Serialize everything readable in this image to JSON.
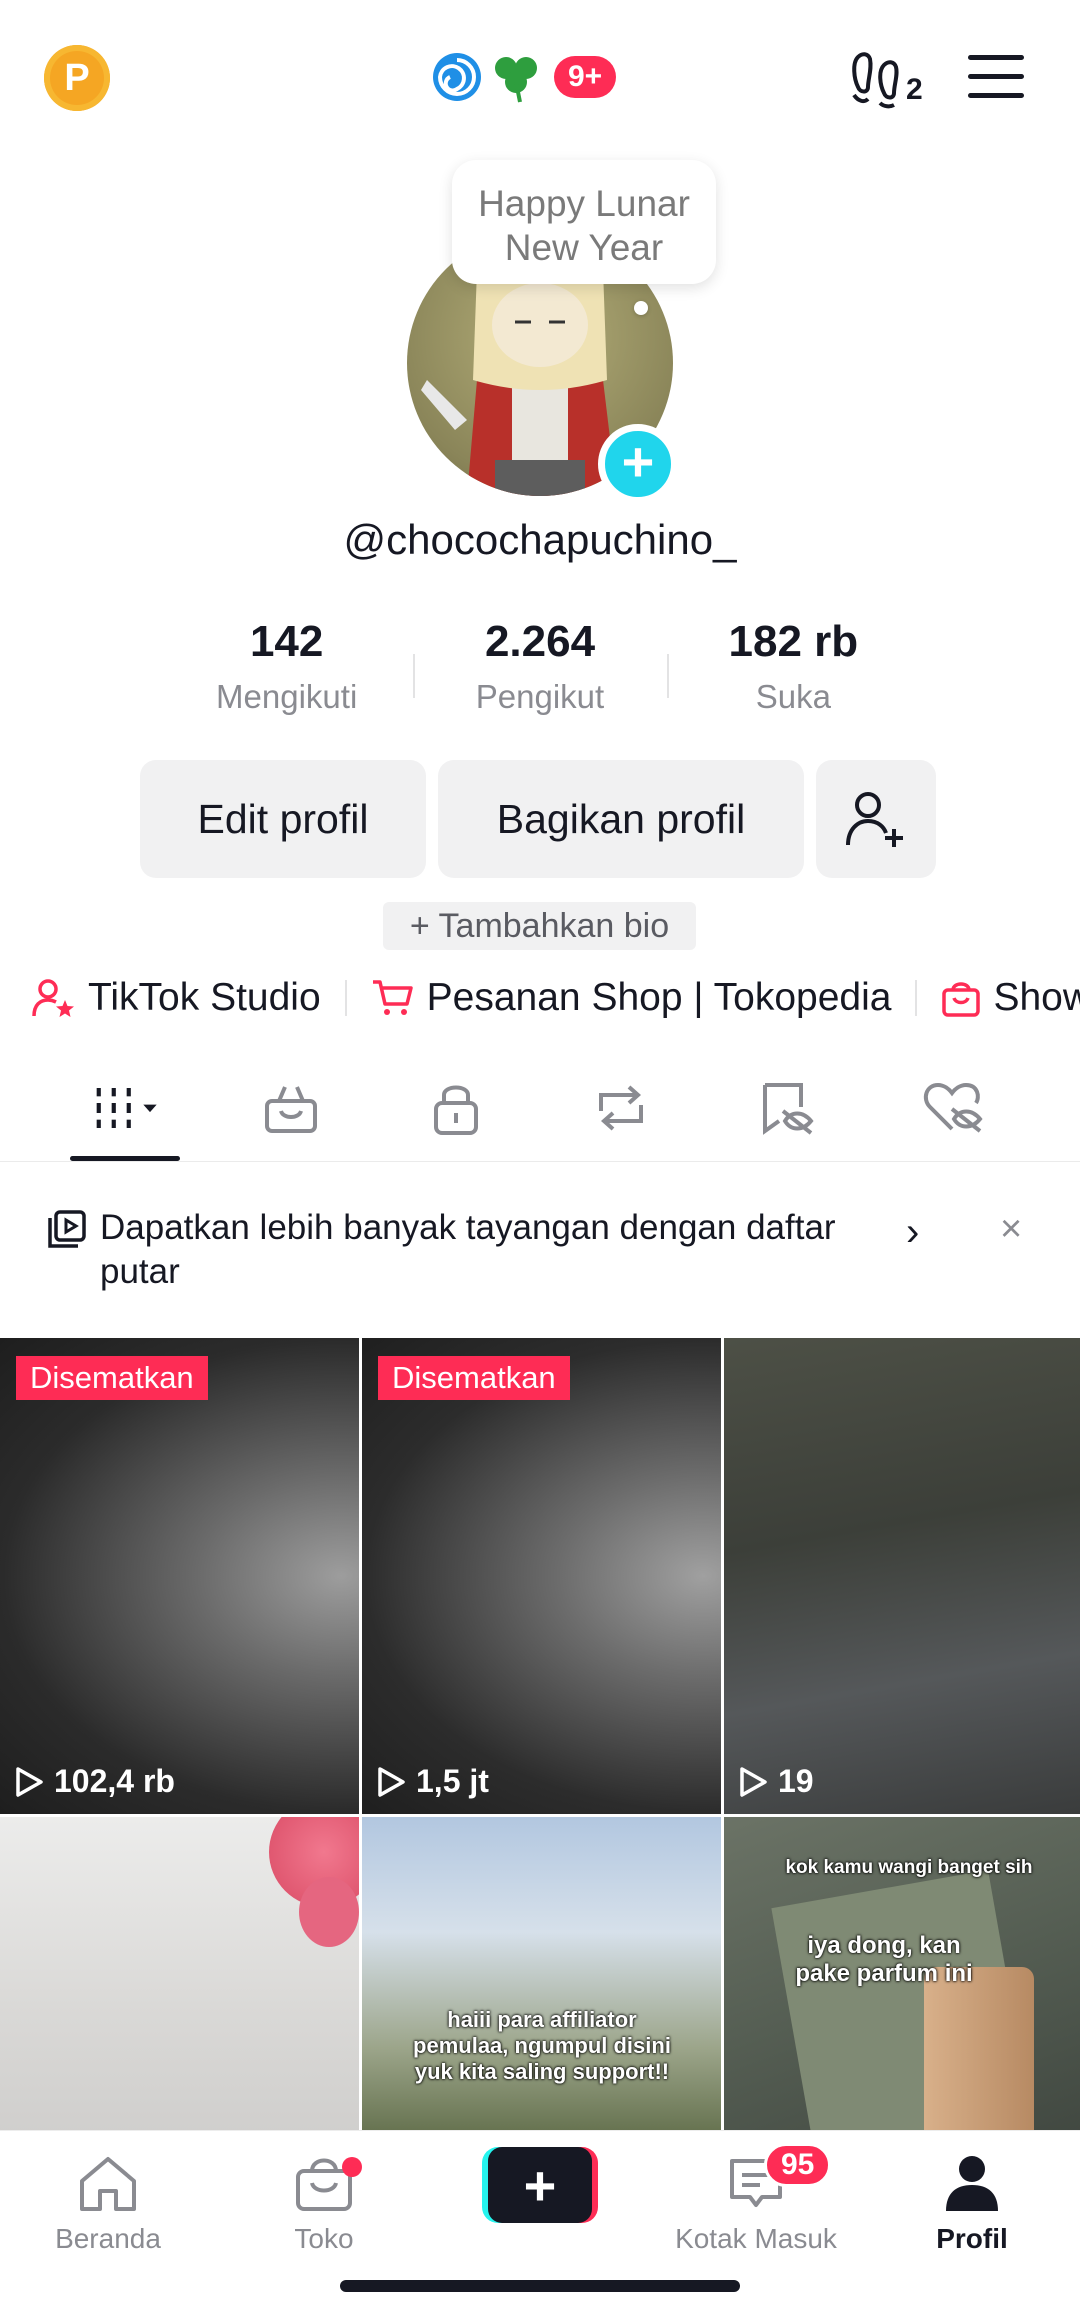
{
  "header": {
    "coin_letter": "P",
    "notification_badge": "9+",
    "footprint_count": "2",
    "tooltip": "Happy Lunar New Year"
  },
  "profile": {
    "username": "@chocochapuchino_",
    "stats": [
      {
        "value": "142",
        "label": "Mengikuti"
      },
      {
        "value": "2.264",
        "label": "Pengikut"
      },
      {
        "value": "182 rb",
        "label": "Suka"
      }
    ],
    "edit_label": "Edit profil",
    "share_label": "Bagikan profil",
    "bio_label": "+ Tambahkan bio"
  },
  "links": [
    {
      "label": "TikTok Studio",
      "icon": "user-star-icon"
    },
    {
      "label": "Pesanan Shop | Tokopedia",
      "icon": "cart-icon"
    },
    {
      "label": "Show",
      "icon": "shop-bag-icon"
    }
  ],
  "tabs": [
    "videos-icon",
    "shop-icon",
    "lock-icon",
    "repost-icon",
    "saved-icon",
    "liked-icon"
  ],
  "playlist_banner": {
    "text": "Dapatkan lebih banyak tayangan dengan daftar putar",
    "chevron": "›",
    "close": "×"
  },
  "videos": [
    {
      "pinned": "Disematkan",
      "views": "102,4 rb"
    },
    {
      "pinned": "Disematkan",
      "views": "1,5 jt"
    },
    {
      "pinned": "",
      "views": "19"
    },
    {
      "caption": ""
    },
    {
      "caption": "haiii para affiliator pemulaa, ngumpul disini yuk kita saling support!!"
    },
    {
      "caption_top": "kok kamu wangi banget sih",
      "caption_mid": "iya dong, kan pake parfum ini"
    }
  ],
  "bottom_nav": [
    {
      "label": "Beranda"
    },
    {
      "label": "Toko"
    },
    {
      "label": "+"
    },
    {
      "label": "Kotak Masuk",
      "badge": "95"
    },
    {
      "label": "Profil"
    }
  ],
  "colors": {
    "accent": "#fe2c55",
    "cyan": "#20d5ec",
    "text": "#161823",
    "muted": "#8a8b91"
  }
}
